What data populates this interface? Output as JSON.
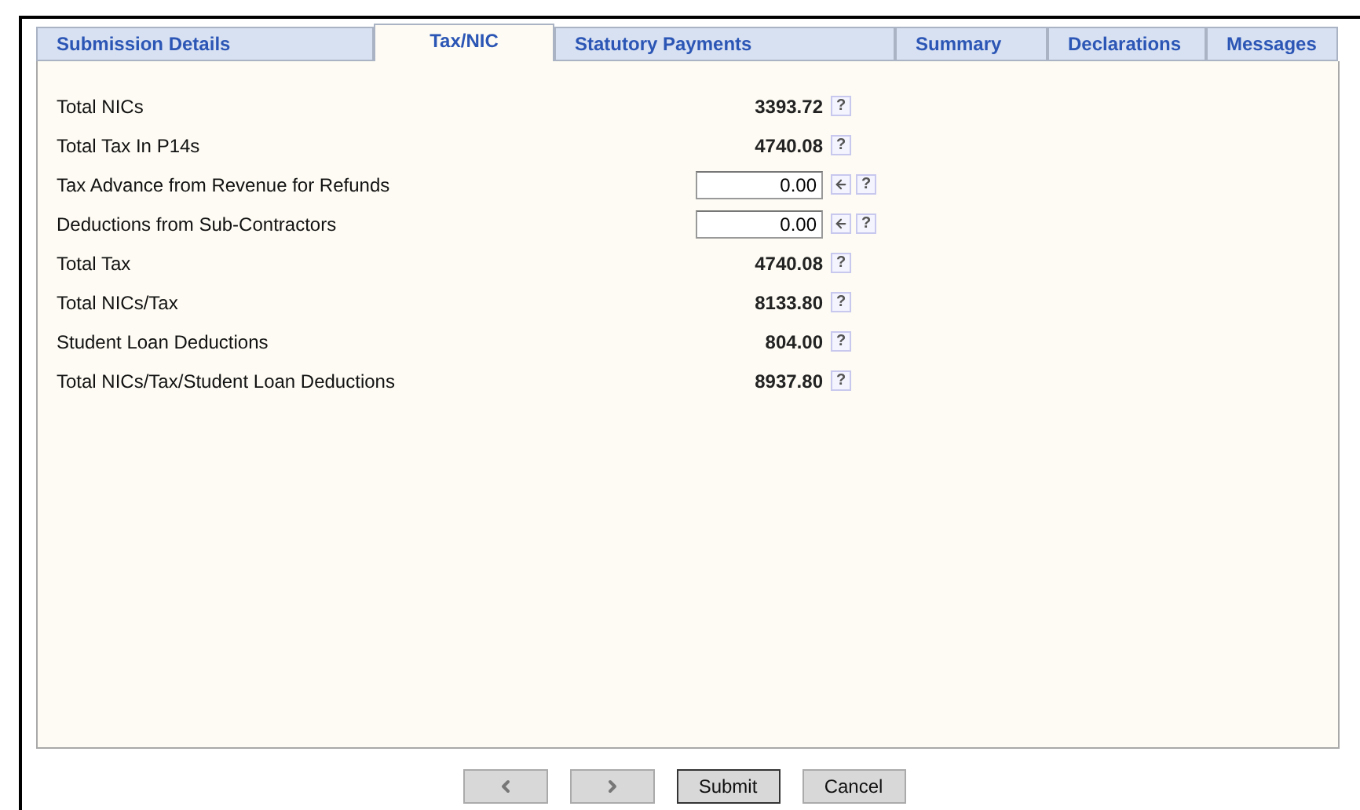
{
  "tabs": [
    {
      "label": "Submission Details",
      "selected": false
    },
    {
      "label": "Tax/NIC",
      "selected": true
    },
    {
      "label": "Statutory Payments",
      "selected": false
    },
    {
      "label": "Summary",
      "selected": false
    },
    {
      "label": "Declarations",
      "selected": false
    },
    {
      "label": "Messages",
      "selected": false
    }
  ],
  "rows": [
    {
      "kind": "value",
      "label": "Total NICs",
      "value": "3393.72",
      "help": "?"
    },
    {
      "kind": "value",
      "label": "Total Tax In P14s",
      "value": "4740.08",
      "help": "?"
    },
    {
      "kind": "input",
      "label": "Tax Advance from Revenue for Refunds",
      "value": "0.00",
      "help": "?"
    },
    {
      "kind": "input",
      "label": "Deductions from Sub-Contractors",
      "value": "0.00",
      "help": "?"
    },
    {
      "kind": "value",
      "label": "Total Tax",
      "value": "4740.08",
      "help": "?"
    },
    {
      "kind": "value",
      "label": "Total NICs/Tax",
      "value": "8133.80",
      "help": "?"
    },
    {
      "kind": "value",
      "label": "Student Loan Deductions",
      "value": "804.00",
      "help": "?"
    },
    {
      "kind": "value",
      "label": "Total NICs/Tax/Student Loan Deductions",
      "value": "8937.80",
      "help": "?"
    }
  ],
  "nav": {
    "previous_disabled": true,
    "next_disabled": true
  },
  "buttons": [
    {
      "label": "Submit",
      "default": true
    },
    {
      "label": "Cancel",
      "default": false
    }
  ]
}
